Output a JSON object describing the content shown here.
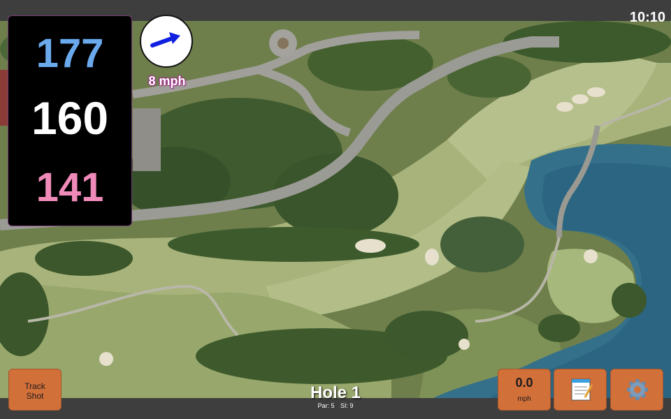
{
  "clock": "10:10",
  "distances": {
    "back": "177",
    "middle": "160",
    "front": "141",
    "colors": {
      "back": "#6aa9ec",
      "middle": "#ffffff",
      "front": "#f08ab8"
    }
  },
  "wind": {
    "speed_label": "8 mph",
    "direction_icon": "arrow-right-icon",
    "arrow_color": "#1020e0"
  },
  "hole": {
    "title": "Hole 1",
    "par_label": "Par: 5",
    "si_label": "SI: 9"
  },
  "buttons": {
    "track_line1": "Track",
    "track_line2": "Shot",
    "speed_value": "0.0",
    "speed_unit": "mph",
    "notes_icon": "notepad-icon",
    "settings_icon": "gear-icon"
  },
  "theme": {
    "button_color": "#d2703a",
    "bar_color": "#3e3e3e"
  }
}
